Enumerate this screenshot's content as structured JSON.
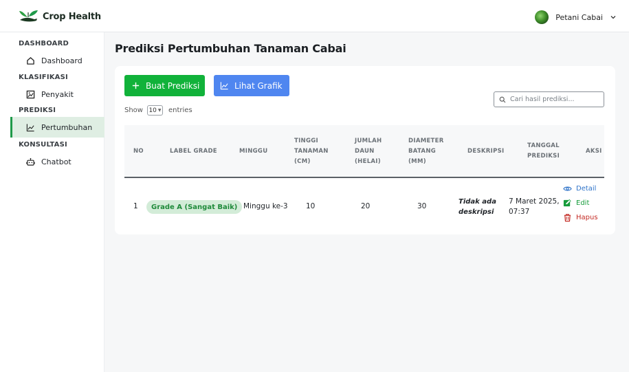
{
  "app": {
    "name": "Crop Health"
  },
  "user": {
    "name": "Petani Cabai"
  },
  "sidebar": {
    "sections": [
      {
        "title": "DASHBOARD",
        "items": [
          {
            "label": "Dashboard",
            "icon": "home-icon"
          }
        ]
      },
      {
        "title": "KLASIFIKASI",
        "items": [
          {
            "label": "Penyakit",
            "icon": "image-icon"
          }
        ]
      },
      {
        "title": "PREDIKSI",
        "items": [
          {
            "label": "Pertumbuhan",
            "icon": "chart-line-icon",
            "active": true
          }
        ]
      },
      {
        "title": "KONSULTASI",
        "items": [
          {
            "label": "Chatbot",
            "icon": "robot-icon"
          }
        ]
      }
    ]
  },
  "page": {
    "title": "Prediksi Pertumbuhan Tanaman Cabai"
  },
  "toolbar": {
    "create_label": "Buat Prediksi",
    "chart_label": "Lihat Grafik",
    "show_label": "Show",
    "entries_value": "10",
    "entries_label": "entries",
    "search_placeholder": "Cari hasil prediksi..."
  },
  "table": {
    "columns": [
      "NO",
      "LABEL GRADE",
      "MINGGU",
      [
        "TINGGI",
        "TANAMAN",
        "(CM)"
      ],
      [
        "JUMLAH",
        "DAUN",
        "(HELAI)"
      ],
      [
        "DIAMETER",
        "BATANG",
        "(MM)"
      ],
      "DESKRIPSI",
      [
        "TANGGAL",
        "PREDIKSI"
      ],
      "AKSI"
    ],
    "rows": [
      {
        "no": "1",
        "grade": "Grade A (Sangat Baik)",
        "minggu": "Minggu ke-3",
        "tinggi": "10",
        "daun": "20",
        "diameter": "30",
        "deskripsi": [
          "Tidak ada",
          "deskripsi"
        ],
        "tanggal": [
          "7 Maret 2025,",
          "07:37"
        ]
      }
    ],
    "actions": {
      "detail": "Detail",
      "edit": "Edit",
      "hapus": "Hapus"
    }
  },
  "colors": {
    "brand_green": "#11b23a",
    "chart_blue": "#4f86f0",
    "grade_badge_bg": "#d3ecd8",
    "detail_blue": "#2e73c9",
    "delete_red": "#c42b24"
  }
}
